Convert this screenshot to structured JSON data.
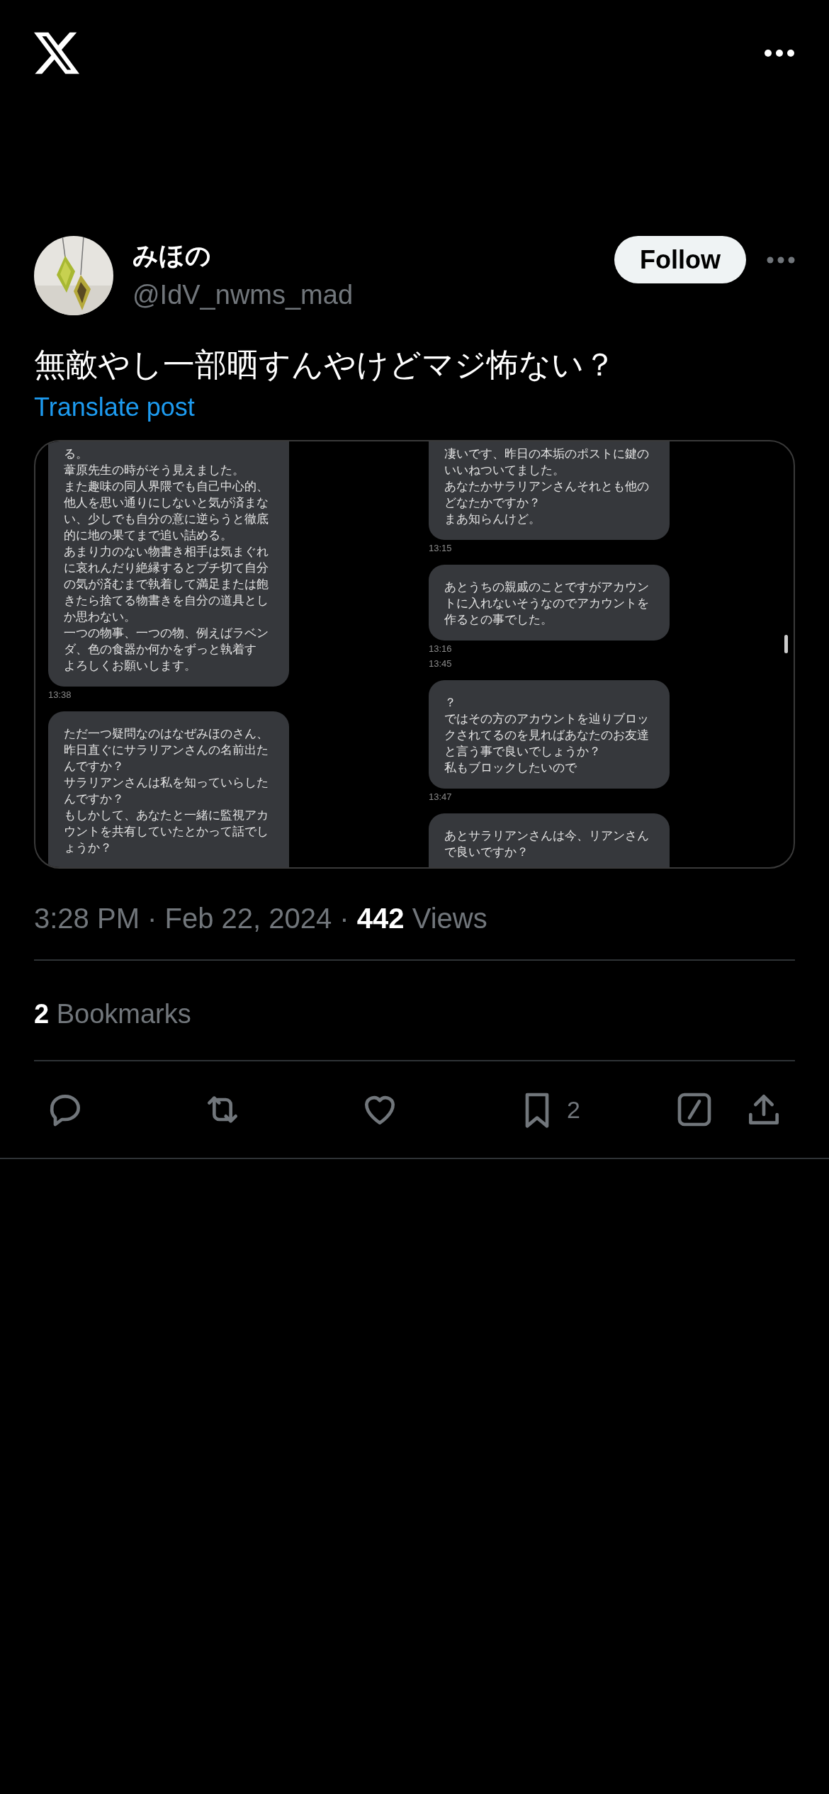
{
  "post": {
    "author": {
      "name": "みほの",
      "handle": "@IdV_nwms_mad"
    },
    "follow_button": "Follow",
    "text": "無敵やし一部晒すんやけどマジ怖ない？",
    "translate_link": "Translate post",
    "media": {
      "kind": "screenshot",
      "left_column": [
        {
          "kind": "bubble",
          "cut_top": true,
          "cut_bottom": false,
          "lines": [
            "る。",
            "葦原先生の時がそう見えました。",
            "また趣味の同人界隈でも自己中心的、",
            "他人を思い通りにしないと気が済まな",
            "い、少しでも自分の意に逆らうと徹底",
            "的に地の果てまで追い詰める。",
            "あまり力のない物書き相手は気まぐれ",
            "に哀れんだり絶縁するとブチ切て自分",
            "の気が済むまで執着して満足または飽",
            "きたら捨てる物書きを自分の道具とし",
            "か思わない。",
            "一つの物事、一つの物、例えばラベン",
            "ダ、色の食器か何かをずっと執着す",
            "よろしくお願いします。"
          ]
        },
        {
          "kind": "time",
          "text": "13:38"
        },
        {
          "kind": "bubble",
          "cut_top": false,
          "cut_bottom": true,
          "lines": [
            "ただ一つ疑問なのはなぜみほのさん、",
            "昨日直ぐにサラリアンさんの名前出た",
            "んですか？",
            "サラリアンさんは私を知っていらした",
            "んですか？",
            "もしかして、あなたと一緒に監視アカ",
            "ウントを共有していたとかって話でし",
            "ょうか？"
          ]
        }
      ],
      "right_column": [
        {
          "kind": "bubble",
          "cut_top": true,
          "cut_bottom": false,
          "lines": [
            "凄いです、昨日の本垢のポストに鍵の",
            "いいねついてました。",
            "あなたかサラリアンさんそれとも他の",
            "どなたかですか？",
            "まあ知らんけど。"
          ]
        },
        {
          "kind": "time",
          "text": "13:15"
        },
        {
          "kind": "bubble",
          "cut_top": false,
          "cut_bottom": false,
          "lines": [
            "あとうちの親戚のことですがアカウン",
            "トに入れないそうなのでアカウントを",
            "作るとの事でした。"
          ]
        },
        {
          "kind": "time",
          "text": "13:16"
        },
        {
          "kind": "time",
          "text": "13:45"
        },
        {
          "kind": "bubble",
          "cut_top": false,
          "cut_bottom": false,
          "lines": [
            "？",
            "ではその方のアカウントを辿りブロッ",
            "クされてるのを見ればあなたのお友達",
            "と言う事で良いでしょうか？",
            "私もブロックしたいので"
          ]
        },
        {
          "kind": "time",
          "text": "13:47"
        },
        {
          "kind": "bubble",
          "cut_top": false,
          "cut_bottom": true,
          "lines": [
            "あとサラリアンさんは今、リアンさん",
            "で良いですか？"
          ]
        }
      ]
    },
    "timestamp": "3:28 PM · Feb 22, 2024 · **442** Views",
    "bookmarks": "**2** Bookmarks",
    "actions": [
      {
        "kind": "reply"
      },
      {
        "kind": "repost"
      },
      {
        "kind": "like"
      },
      {
        "kind": "bookmark",
        "count": "2"
      },
      {
        "kind": "grok"
      },
      {
        "kind": "share"
      }
    ]
  }
}
